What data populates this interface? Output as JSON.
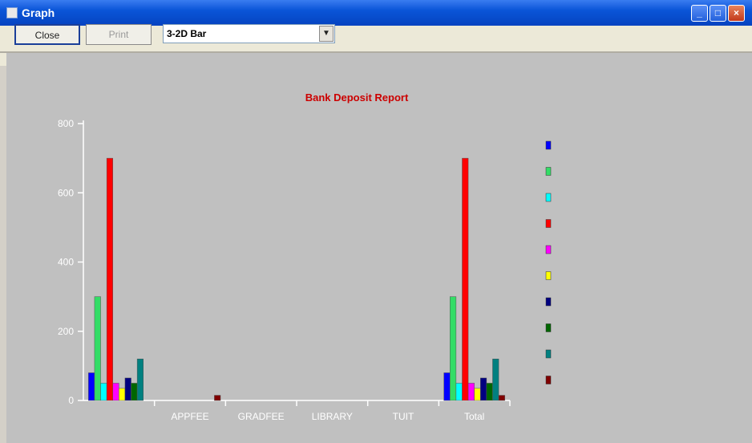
{
  "window": {
    "title": "Graph",
    "btn_minimize": "_",
    "btn_maximize": "□",
    "btn_close": "×"
  },
  "toolbar": {
    "close_label": "Close",
    "print_label": "Print",
    "chart_type_value": "3-2D Bar"
  },
  "chart_data": {
    "type": "bar",
    "title": "Bank Deposit Report",
    "categories": [
      "",
      "APPFEE",
      "GRADFEE",
      "LIBRARY",
      "TUIT",
      "Total"
    ],
    "ylim": [
      0,
      800
    ],
    "yticks": [
      0,
      200,
      400,
      600,
      800
    ],
    "grid": false,
    "legend_position": "right",
    "series": [
      {
        "color": "#0000ff",
        "values": [
          80,
          0,
          0,
          0,
          0,
          80
        ]
      },
      {
        "color": "#33dd66",
        "values": [
          300,
          0,
          0,
          0,
          0,
          300
        ]
      },
      {
        "color": "#00ffff",
        "values": [
          50,
          0,
          0,
          0,
          0,
          50
        ]
      },
      {
        "color": "#ff0000",
        "values": [
          700,
          0,
          0,
          0,
          0,
          700
        ]
      },
      {
        "color": "#ff00ff",
        "values": [
          50,
          0,
          0,
          0,
          0,
          50
        ]
      },
      {
        "color": "#ffff00",
        "values": [
          35,
          0,
          0,
          0,
          0,
          35
        ]
      },
      {
        "color": "#000080",
        "values": [
          65,
          0,
          0,
          0,
          0,
          65
        ]
      },
      {
        "color": "#006600",
        "values": [
          50,
          0,
          0,
          0,
          0,
          50
        ]
      },
      {
        "color": "#008080",
        "values": [
          120,
          0,
          0,
          0,
          0,
          120
        ]
      },
      {
        "color": "#800000",
        "values": [
          0,
          15,
          0,
          0,
          0,
          15
        ]
      }
    ]
  }
}
